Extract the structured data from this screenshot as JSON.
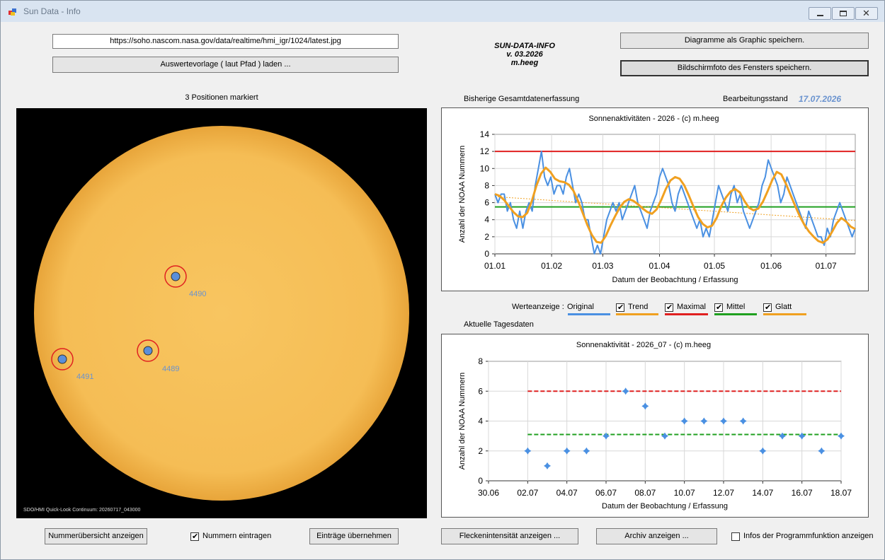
{
  "window": {
    "title": "Sun Data - Info"
  },
  "header": {
    "url": "https://soho.nascom.nasa.gov/data/realtime/hmi_igr/1024/latest.jpg",
    "load_template_label": "Auswertevorlage ( laut Pfad ) laden ...",
    "app_name": "SUN-DATA-INFO",
    "version": "v. 03.2026",
    "author": "m.heeg",
    "save_diagrams_label": "Diagramme als Graphic speichern.",
    "save_screenshot_label": "Bildschirmfoto des Fensters speichern."
  },
  "sun": {
    "positions_label": "3 Positionen markiert",
    "caption": "SDO/HMI Quick-Look Continuum: 20260717_043000",
    "colors": {
      "disk": "#f7c25a",
      "marker_ring": "#e02020",
      "marker_dot": "#5b8fd9",
      "number": "#6a93cf"
    },
    "markers": [
      {
        "number": "4490"
      },
      {
        "number": "4489"
      },
      {
        "number": "4491"
      }
    ]
  },
  "overview": {
    "section_label": "Bisherige Gesamtdatenerfassung",
    "status_label": "Bearbeitungsstand",
    "status_date": "17.07.2026"
  },
  "legend": {
    "prefix": "Werteanzeige :",
    "items": [
      {
        "label": "Original",
        "checked": null,
        "color": "#4a90e2"
      },
      {
        "label": "Trend",
        "checked": true,
        "color": "#f0a020"
      },
      {
        "label": "Maximal",
        "checked": true,
        "color": "#e02020"
      },
      {
        "label": "Mittel",
        "checked": true,
        "color": "#20a020"
      },
      {
        "label": "Glatt",
        "checked": true,
        "color": "#f0a020"
      }
    ]
  },
  "daily": {
    "section_label": "Aktuelle Tagesdaten"
  },
  "bottom": {
    "show_numbers_label": "Nummerübersicht anzeigen",
    "enter_numbers_label": "Nummern eintragen",
    "enter_numbers_checked": true,
    "apply_label": "Einträge übernehmen",
    "intensity_label": "Fleckenintensität anzeigen ...",
    "archive_label": "Archiv anzeigen ...",
    "info_label": "Infos der Programmfunktion anzeigen",
    "info_checked": false
  },
  "chart_data": [
    {
      "type": "line",
      "title": "Sonnenaktivitäten - 2026 - (c) m.heeg",
      "xlabel": "Datum der Beobachtung / Erfassung",
      "ylabel": "Anzahl der NOAA Nummern",
      "xticks": [
        "01.01",
        "01.02",
        "01.03",
        "01.04",
        "01.05",
        "01.06",
        "01.07"
      ],
      "xlim_days": [
        0,
        197
      ],
      "ylim": [
        0,
        14
      ],
      "yticks": [
        0,
        2,
        4,
        6,
        8,
        10,
        12,
        14
      ],
      "grid": true,
      "series": [
        {
          "name": "Original",
          "color": "#4a90e2",
          "values": [
            7,
            6,
            7,
            7,
            5,
            6,
            4,
            3,
            5,
            3,
            5,
            6,
            5,
            8,
            10,
            12,
            9,
            8,
            9,
            7,
            8,
            8,
            7,
            9,
            10,
            8,
            6,
            7,
            6,
            4,
            4,
            2,
            0,
            1,
            0,
            2,
            4,
            5,
            6,
            5,
            6,
            4,
            5,
            6,
            7,
            8,
            6,
            5,
            4,
            3,
            5,
            6,
            7,
            9,
            10,
            9,
            8,
            6,
            5,
            7,
            8,
            7,
            6,
            5,
            4,
            3,
            4,
            2,
            3,
            2,
            4,
            6,
            8,
            7,
            6,
            5,
            7,
            8,
            6,
            7,
            5,
            4,
            3,
            4,
            5,
            6,
            8,
            9,
            11,
            10,
            9,
            8,
            6,
            7,
            9,
            8,
            7,
            6,
            5,
            4,
            3,
            5,
            4,
            3,
            2,
            2,
            1,
            3,
            2,
            4,
            5,
            6,
            5,
            4,
            3,
            2,
            3
          ]
        },
        {
          "name": "Glatt",
          "color": "#f0a020",
          "values": [
            7,
            6.8,
            6.3,
            5.6,
            4.9,
            4.4,
            4.3,
            4.8,
            6.2,
            8.0,
            9.4,
            10.1,
            9.6,
            8.8,
            8.5,
            8.4,
            8.1,
            7.4,
            6.2,
            4.8,
            3.4,
            2.2,
            1.4,
            1.3,
            2.1,
            3.3,
            4.4,
            5.4,
            6.1,
            6.4,
            6.2,
            5.8,
            5.3,
            4.9,
            4.7,
            5.2,
            6.3,
            7.6,
            8.6,
            9.0,
            8.8,
            8.0,
            6.8,
            5.5,
            4.3,
            3.5,
            3.1,
            3.3,
            4.2,
            5.6,
            6.6,
            7.3,
            7.6,
            7.2,
            6.2,
            5.4,
            5.1,
            5.3,
            6.1,
            7.3,
            8.6,
            9.6,
            9.3,
            8.2,
            6.9,
            5.6,
            4.4,
            3.4,
            2.6,
            2.0,
            1.5,
            1.3,
            1.7,
            2.6,
            3.6,
            4.2,
            3.8,
            3.2,
            2.9
          ]
        },
        {
          "name": "Trend",
          "color": "#f0a020",
          "from": 6.7,
          "to": 3.9
        },
        {
          "name": "Maximal",
          "color": "#e02020",
          "value": 12
        },
        {
          "name": "Mittel",
          "color": "#20a020",
          "value": 5.5
        }
      ]
    },
    {
      "type": "scatter",
      "title": "Sonnenaktivität - 2026_07 - (c) m.heeg",
      "xlabel": "Datum der Beobachtung / Erfassung",
      "ylabel": "Anzahl der NOAA Nummern",
      "xticks": [
        "30.06",
        "02.07",
        "04.07",
        "06.07",
        "08.07",
        "10.07",
        "12.07",
        "14.07",
        "16.07",
        "18.07"
      ],
      "xlim_days": [
        -1,
        17
      ],
      "ylim": [
        0,
        8
      ],
      "yticks": [
        0,
        2,
        4,
        6,
        8
      ],
      "grid": true,
      "points": {
        "day": [
          1,
          2,
          3,
          4,
          5,
          6,
          7,
          8,
          9,
          10,
          11,
          12,
          13,
          14,
          15,
          16,
          17
        ],
        "value": [
          2,
          1,
          2,
          2,
          3,
          6,
          5,
          3,
          4,
          4,
          4,
          4,
          2,
          3,
          3,
          2,
          3
        ],
        "color": "#4a90e2"
      },
      "max_line": {
        "value": 6,
        "color": "#e02020"
      },
      "mean_line": {
        "value": 3.1,
        "color": "#20a020"
      }
    }
  ]
}
